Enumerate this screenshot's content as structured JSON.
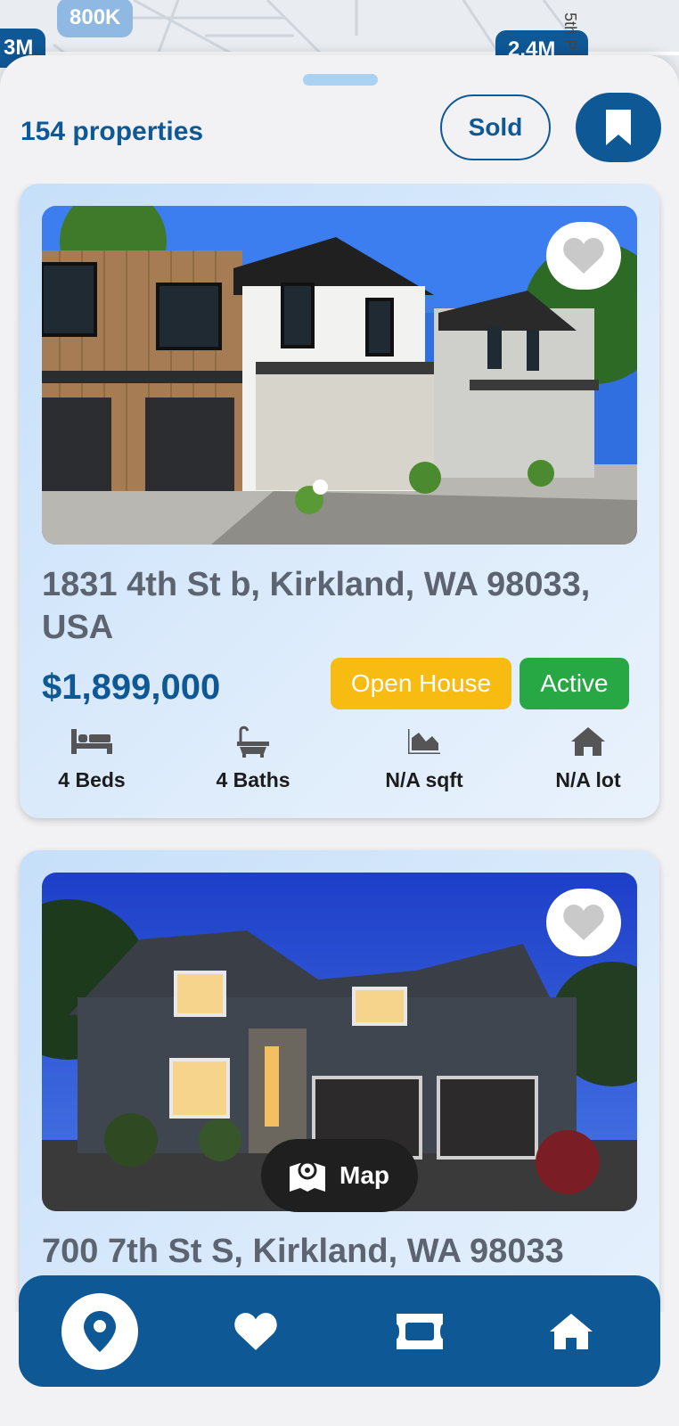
{
  "map": {
    "price_pins": [
      "800K",
      "3M",
      "2.4M"
    ],
    "street_label": "5th P"
  },
  "header": {
    "count_label": "154 properties",
    "sold_label": "Sold"
  },
  "listings": [
    {
      "address": "1831 4th St b, Kirkland, WA 98033, USA",
      "price": "$1,899,000",
      "badges": [
        "Open House",
        "Active"
      ],
      "stats": [
        {
          "icon": "bed-icon",
          "label": "4 Beds"
        },
        {
          "icon": "bath-icon",
          "label": "4 Baths"
        },
        {
          "icon": "area-chart-icon",
          "label": "N/A sqft"
        },
        {
          "icon": "house-icon",
          "label": "N/A lot"
        }
      ]
    },
    {
      "address": "700 7th St S, Kirkland, WA 98033"
    }
  ],
  "map_button_label": "Map",
  "tabs": [
    {
      "icon": "map-pin-icon",
      "active": true
    },
    {
      "icon": "heart-icon",
      "active": false
    },
    {
      "icon": "ticket-icon",
      "active": false
    },
    {
      "icon": "home-icon",
      "active": false
    }
  ],
  "colors": {
    "primary": "#0f5896",
    "open_house": "#f7bb12",
    "active": "#28a745"
  }
}
